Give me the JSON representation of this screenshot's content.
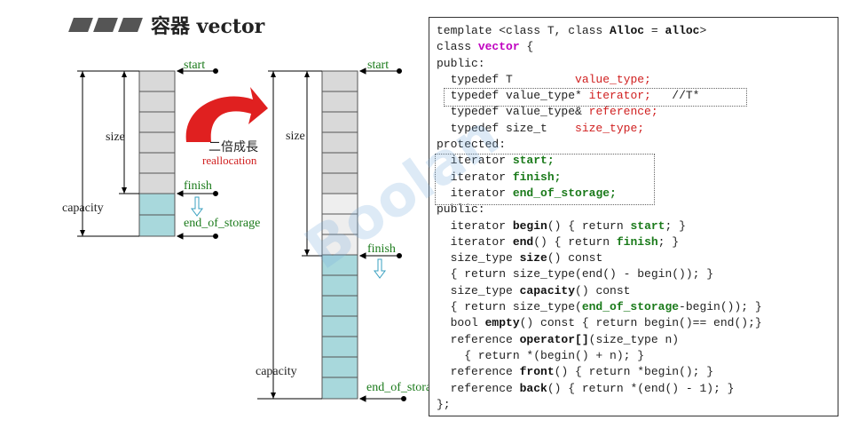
{
  "title": "容器 vector",
  "left_diagram": {
    "start": "start",
    "finish": "finish",
    "end_of_storage": "end_of_storage",
    "size": "size",
    "capacity": "capacity"
  },
  "arrow": {
    "line1": "二倍成長",
    "line2": "reallocation"
  },
  "right_diagram": {
    "start": "start",
    "finish": "finish",
    "end_of_storage": "end_of_storage",
    "size": "size",
    "capacity": "capacity"
  },
  "watermark": "Boolan",
  "code": [
    "template <class T, class Alloc = alloc>",
    "class vector {",
    "public:",
    "  typedef T         value_type;",
    "  typedef value_type* iterator;   //T*",
    "  typedef value_type& reference;",
    "  typedef size_t    size_type;",
    "protected:",
    "  iterator start;",
    "  iterator finish;",
    "  iterator end_of_storage;",
    "public:",
    "  iterator begin() { return start; }",
    "  iterator end() { return finish; }",
    "  size_type size() const",
    "  { return size_type(end() - begin()); }",
    "  size_type capacity() const",
    "  { return size_type(end_of_storage-begin()); }",
    "  bool empty() const { return begin()== end();}",
    "  reference operator[](size_type n)",
    "    { return *(begin() + n); }",
    "  reference front() { return *begin(); }",
    "  reference back() { return *(end() - 1); }",
    "};"
  ]
}
